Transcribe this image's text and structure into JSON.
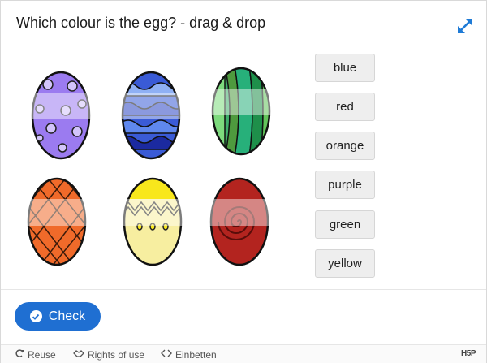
{
  "task": {
    "title": "Which colour is the egg? - drag & drop"
  },
  "draggables": [
    "blue",
    "red",
    "orange",
    "purple",
    "green",
    "yellow"
  ],
  "actions": {
    "check_label": "Check"
  },
  "footer": {
    "reuse": "Reuse",
    "rights": "Rights of use",
    "embed": "Einbetten",
    "brand": "H5P"
  },
  "colors": {
    "primary": "#1f6fd2",
    "fullscreen_icon": "#1f7bd6"
  },
  "icons": [
    "fullscreen-icon",
    "check-circle-icon",
    "reuse-icon",
    "handshake-icon",
    "code-icon"
  ]
}
